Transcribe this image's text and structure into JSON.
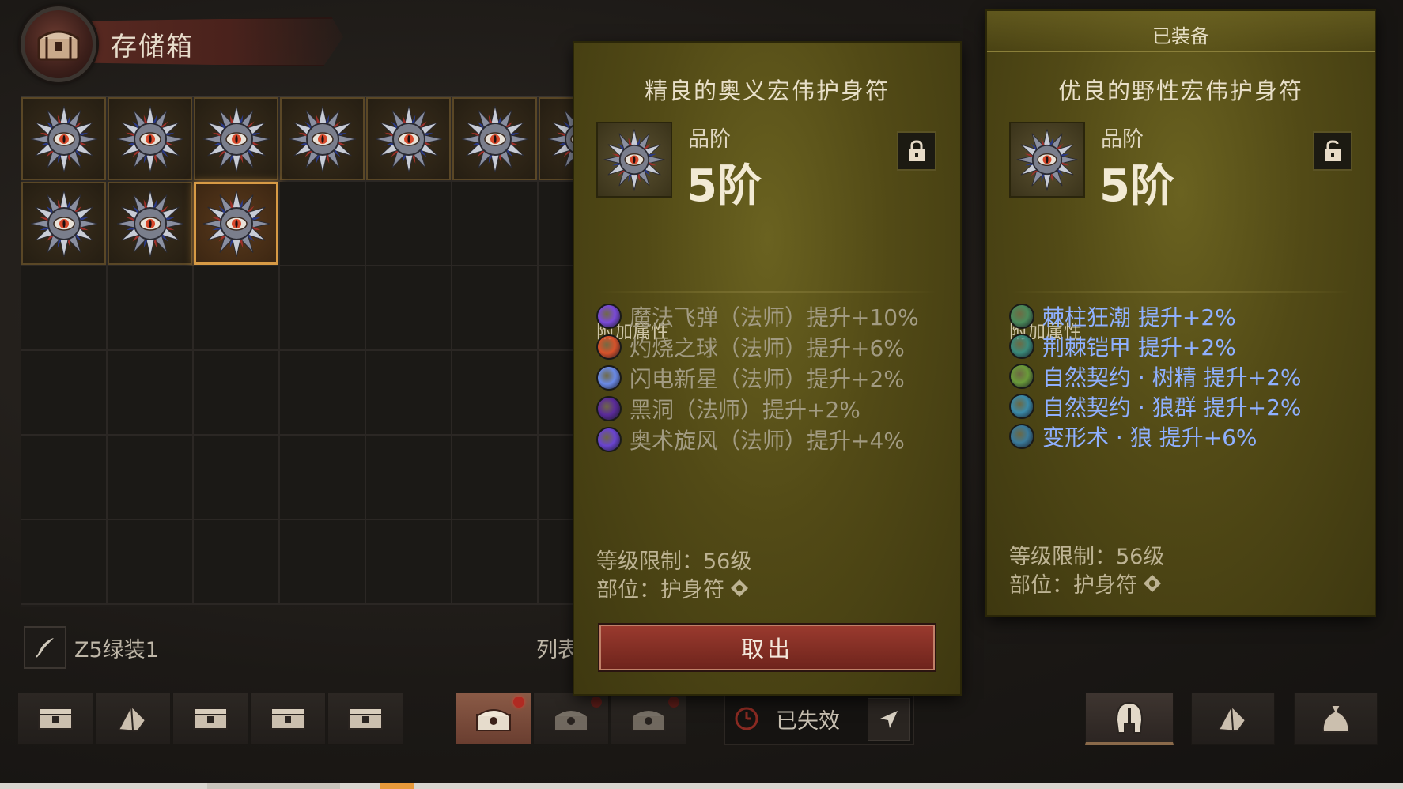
{
  "stash": {
    "title": "存储箱",
    "item_count": 10,
    "selected_index": 9
  },
  "list": {
    "name": "Z5绿装1",
    "label": "列表"
  },
  "tabs": {
    "expired_text": "已失效"
  },
  "compare": {
    "equipped_header": "已装备",
    "left": {
      "title": "精良的奥义宏伟护身符",
      "grade_label": "品阶",
      "grade_value": "5阶",
      "attrs_label": "附加属性",
      "attrs": [
        {
          "text": "魔法飞弹（法师）提升+10%",
          "icon": "magic-missile-icon",
          "color": "#7a4ad8"
        },
        {
          "text": "灼烧之球（法师）提升+6%",
          "icon": "burning-orb-icon",
          "color": "#d8522a"
        },
        {
          "text": "闪电新星（法师）提升+2%",
          "icon": "lightning-nova-icon",
          "color": "#6a8ae8"
        },
        {
          "text": "黑洞（法师）提升+2%",
          "icon": "black-hole-icon",
          "color": "#5a2a9a"
        },
        {
          "text": "奥术旋风（法师）提升+4%",
          "icon": "arcane-whirlwind-icon",
          "color": "#6a44d0"
        }
      ],
      "level_req": "等级限制：56级",
      "slot": "部位：护身符",
      "take_button": "取出"
    },
    "right": {
      "title": "优良的野性宏伟护身符",
      "grade_label": "品阶",
      "grade_value": "5阶",
      "attrs_label": "附加属性",
      "attrs": [
        {
          "text": "棘柱狂潮 提升+2%",
          "icon": "thorn-surge-icon",
          "color": "#4a8a5a"
        },
        {
          "text": "荆棘铠甲 提升+2%",
          "icon": "thorn-armor-icon",
          "color": "#3a8a7a"
        },
        {
          "text": "自然契约 · 树精 提升+2%",
          "icon": "treant-pact-icon",
          "color": "#6a9a3a"
        },
        {
          "text": "自然契约 · 狼群 提升+2%",
          "icon": "wolf-pact-icon",
          "color": "#3a8aa8"
        },
        {
          "text": "变形术 · 狼 提升+6%",
          "icon": "werewolf-icon",
          "color": "#3a7a9a"
        }
      ],
      "level_req": "等级限制：56级",
      "slot": "部位：护身符"
    }
  }
}
